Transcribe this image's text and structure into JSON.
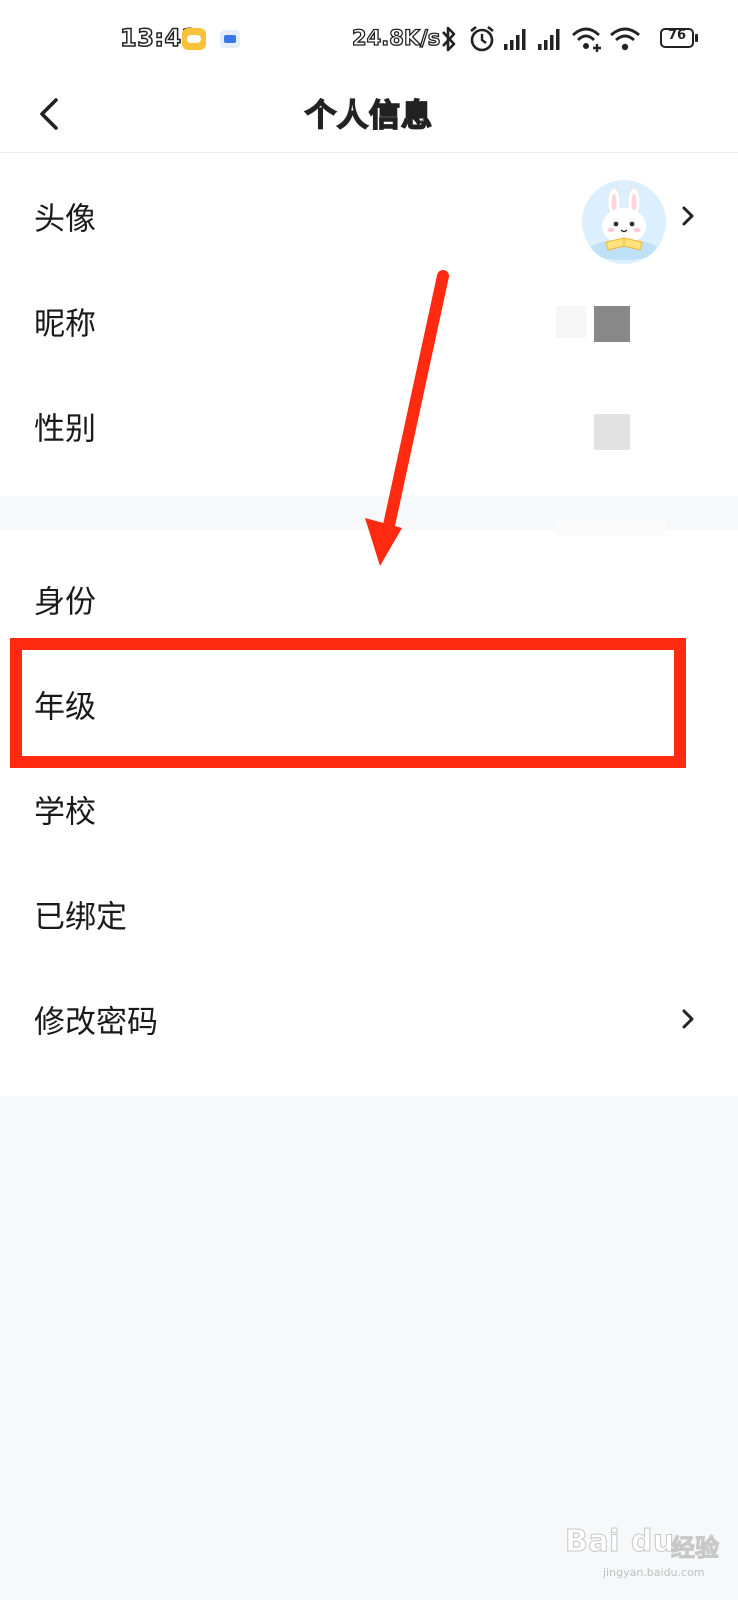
{
  "status_bar": {
    "time": "13:42",
    "net_speed": "24.8K/s",
    "battery": "76",
    "icons": [
      "message-notification-icon",
      "gallery-notification-icon",
      "bluetooth-icon",
      "alarm-icon",
      "signal-icon",
      "signal-icon",
      "wifi-calling-icon",
      "wifi-icon",
      "battery-icon"
    ]
  },
  "header": {
    "title": "个人信息",
    "back_icon": "chevron-left-icon"
  },
  "section_1": {
    "rows": [
      {
        "label": "头像",
        "trailing": "avatar",
        "chevron": true
      },
      {
        "label": "昵称",
        "trailing": "redacted"
      },
      {
        "label": "性别",
        "trailing": "redacted"
      }
    ]
  },
  "section_2": {
    "rows": [
      {
        "label": "身份"
      },
      {
        "label": "年级",
        "highlighted": true
      },
      {
        "label": "学校"
      },
      {
        "label": "已绑定"
      },
      {
        "label": "修改密码",
        "chevron": true
      }
    ]
  },
  "annotation": {
    "arrow_color": "#ff2a10",
    "highlight_color": "#ff2a10"
  },
  "watermark": {
    "brand": "Bai du",
    "product": "经验",
    "url": "jingyan.baidu.com"
  }
}
